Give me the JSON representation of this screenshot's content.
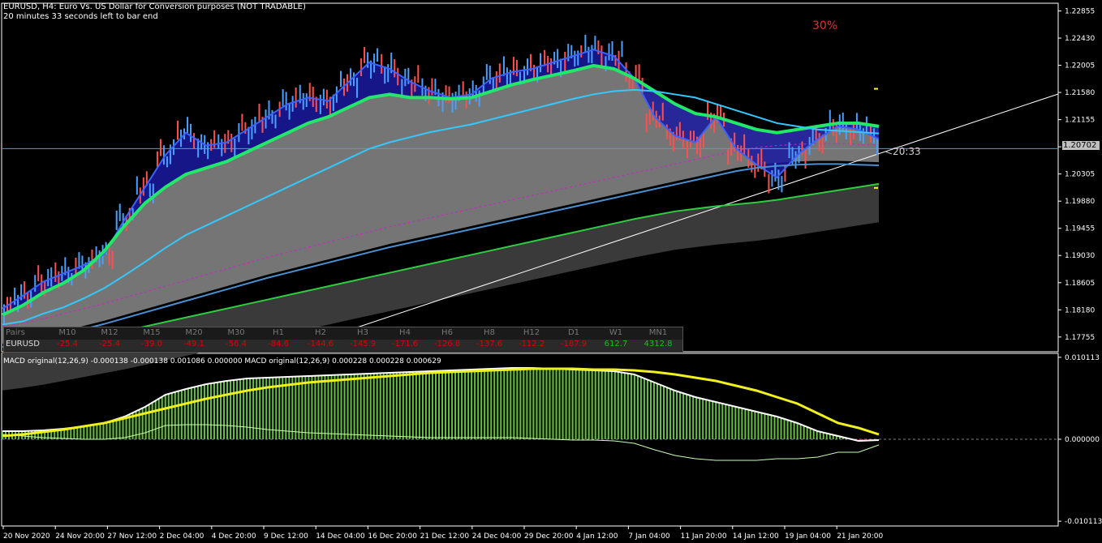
{
  "header": {
    "symbol_line": "EURUSD, H4:  Euro Vs. US Dollar for Conversion purposes (NOT TRADABLE)",
    "timer_line": "20 minutes 33 seconds left to bar end",
    "percent_label": "30%",
    "countdown_label": "<20:33",
    "current_price": "1.20702"
  },
  "macd": {
    "label": "MACD original(12,26,9) -0.000138 -0.000138 0.001086 0.000000 MACD original(12,26,9) 0.000228 0.000228 0.000629"
  },
  "mtf_table": {
    "header_label": "Pairs",
    "symbol": "EURUSD",
    "columns": [
      "M10",
      "M12",
      "M15",
      "M20",
      "M30",
      "H1",
      "H2",
      "H3",
      "H4",
      "H6",
      "H8",
      "H12",
      "D1",
      "W1",
      "MN1"
    ],
    "values": [
      "-25.4",
      "-25.4",
      "-39.0",
      "-49.1",
      "-56.4",
      "-84.6",
      "-144.6",
      "-145.9",
      "-171.6",
      "-126.8",
      "-137.6",
      "-112.2",
      "-187.9",
      "612.7",
      "4312.8"
    ],
    "value_colors": [
      "#e00000",
      "#e00000",
      "#e00000",
      "#e00000",
      "#e00000",
      "#e00000",
      "#e00000",
      "#e00000",
      "#e00000",
      "#e00000",
      "#e00000",
      "#e00000",
      "#e00000",
      "#18c018",
      "#18c018"
    ]
  },
  "chart_data": [
    {
      "type": "line",
      "title": "",
      "y_axis_ticks": [
        "1.22855",
        "1.22430",
        "1.22005",
        "1.21580",
        "1.21155",
        "1.20730",
        "1.20305",
        "1.19880",
        "1.19455",
        "1.19030",
        "1.18605",
        "1.18180",
        "1.17755"
      ],
      "ylim": [
        1.1755,
        1.2295
      ],
      "x_axis_ticks": [
        "20 Nov 2020",
        "24 Nov 20:00",
        "27 Nov 12:00",
        "2 Dec 04:00",
        "4 Dec 20:00",
        "9 Dec 12:00",
        "14 Dec 04:00",
        "16 Dec 20:00",
        "21 Dec 12:00",
        "24 Dec 04:00",
        "29 Dec 20:00",
        "4 Jan 12:00",
        "7 Jan 04:00",
        "11 Jan 20:00",
        "14 Jan 12:00",
        "19 Jan 04:00",
        "21 Jan 20:00"
      ],
      "series": [
        {
          "values": [
            1.182,
            1.184,
            1.1862,
            1.1875,
            1.1888,
            1.1905,
            1.196,
            1.201,
            1.206,
            1.2095,
            1.2075,
            1.208,
            1.21,
            1.212,
            1.214,
            1.215,
            1.2145,
            1.2175,
            1.2205,
            1.2195,
            1.2175,
            1.216,
            1.215,
            1.2155,
            1.218,
            1.219,
            1.2195,
            1.2205,
            1.2215,
            1.2225,
            1.2215,
            1.218,
            1.212,
            1.209,
            1.208,
            1.212,
            1.207,
            1.2045,
            1.2025,
            1.206,
            1.2085,
            1.2105,
            1.21,
            1.2085
          ]
        },
        {
          "values": [
            1.181,
            1.1825,
            1.1845,
            1.186,
            1.188,
            1.191,
            1.195,
            1.1985,
            1.201,
            1.203,
            1.204,
            1.205,
            1.2065,
            1.208,
            1.2095,
            1.211,
            1.212,
            1.2135,
            1.215,
            1.2155,
            1.215,
            1.215,
            1.2148,
            1.215,
            1.216,
            1.217,
            1.2178,
            1.2185,
            1.2192,
            1.22,
            1.2195,
            1.218,
            1.216,
            1.214,
            1.2125,
            1.212,
            1.211,
            1.21,
            1.2095,
            1.21,
            1.2105,
            1.211,
            1.211,
            1.2105
          ]
        },
        {
          "values": [
            1.1795,
            1.18,
            1.1812,
            1.1822,
            1.1836,
            1.1852,
            1.1872,
            1.1893,
            1.1915,
            1.1935,
            1.195,
            1.1965,
            1.198,
            1.1995,
            1.201,
            1.2025,
            1.204,
            1.2055,
            1.207,
            1.208,
            1.2088,
            1.2096,
            1.2102,
            1.2108,
            1.2116,
            1.2124,
            1.2132,
            1.214,
            1.2148,
            1.2155,
            1.216,
            1.2162,
            1.216,
            1.2155,
            1.215,
            1.214,
            1.213,
            1.212,
            1.211,
            1.2105,
            1.21,
            1.2098,
            1.2096,
            1.2094
          ]
        },
        {
          "values": [
            1.176,
            1.1765,
            1.1772,
            1.178,
            1.1788,
            1.1796,
            1.1805,
            1.1814,
            1.1823,
            1.1832,
            1.1841,
            1.185,
            1.1859,
            1.1868,
            1.1876,
            1.1884,
            1.1892,
            1.19,
            1.1908,
            1.1916,
            1.1923,
            1.193,
            1.1937,
            1.1944,
            1.1951,
            1.1958,
            1.1965,
            1.1972,
            1.1979,
            1.1986,
            1.1993,
            1.2,
            1.2007,
            1.2014,
            1.2021,
            1.2028,
            1.2035,
            1.204,
            1.2043,
            1.2045,
            1.2046,
            1.2046,
            1.2045,
            1.2044
          ]
        },
        {
          "values": [
            1.1752,
            1.1756,
            1.1761,
            1.1767,
            1.1773,
            1.1779,
            1.1785,
            1.1792,
            1.1799,
            1.1806,
            1.1813,
            1.182,
            1.1827,
            1.1834,
            1.1841,
            1.1848,
            1.1855,
            1.1862,
            1.1869,
            1.1876,
            1.1883,
            1.189,
            1.1897,
            1.1904,
            1.1911,
            1.1918,
            1.1925,
            1.1932,
            1.1939,
            1.1946,
            1.1953,
            1.196,
            1.1966,
            1.1972,
            1.1976,
            1.198,
            1.1983,
            1.1986,
            1.199,
            1.1995,
            1.2,
            1.2005,
            1.201,
            1.2015
          ]
        }
      ],
      "series_colors": [
        "#3c63ff",
        "#22e86a",
        "#34c8ff",
        "#4a8fd0",
        "#2ecc40"
      ],
      "colors": {
        "price_hline": "#3ab0c8",
        "trendline": "#ffffff",
        "ma_dashed": "#d020d0",
        "cloud": "#8a8a8a"
      }
    },
    {
      "type": "bar",
      "title": "",
      "y_axis_ticks": [
        "0.010113",
        "0.000000",
        "-0.010113"
      ],
      "ylim": [
        -0.0105,
        0.0105
      ],
      "series": [
        {
          "values": [
            0.001,
            0.001,
            0.0011,
            0.0013,
            0.0016,
            0.002,
            0.0028,
            0.004,
            0.0055,
            0.0062,
            0.0068,
            0.0072,
            0.0075,
            0.0076,
            0.0077,
            0.0078,
            0.0079,
            0.008,
            0.0081,
            0.0082,
            0.0083,
            0.0084,
            0.0085,
            0.0086,
            0.0087,
            0.0088,
            0.0088,
            0.0087,
            0.0086,
            0.0085,
            0.0084,
            0.008,
            0.007,
            0.006,
            0.0052,
            0.0046,
            0.004,
            0.0034,
            0.0028,
            0.002,
            0.001,
            0.0004,
            -0.0002,
            -0.0001
          ]
        },
        {
          "values": [
            0.0004,
            0.0006,
            0.0009,
            0.0012,
            0.0016,
            0.002,
            0.0026,
            0.0032,
            0.0038,
            0.0044,
            0.005,
            0.0055,
            0.006,
            0.0064,
            0.0067,
            0.007,
            0.0072,
            0.0074,
            0.0076,
            0.0078,
            0.008,
            0.0082,
            0.0083,
            0.0084,
            0.0085,
            0.0086,
            0.0087,
            0.0087,
            0.0087,
            0.0086,
            0.0086,
            0.0085,
            0.0083,
            0.008,
            0.0076,
            0.0072,
            0.0066,
            0.006,
            0.0052,
            0.0044,
            0.0032,
            0.002,
            0.0014,
            0.0006
          ]
        },
        {
          "values": [
            0.0006,
            0.0004,
            0.0002,
            0.0001,
            0.0,
            0.0,
            0.0002,
            0.0008,
            0.0017,
            0.0018,
            0.0018,
            0.0017,
            0.0015,
            0.0012,
            0.001,
            0.0008,
            0.0007,
            0.0006,
            0.0005,
            0.0004,
            0.0003,
            0.0002,
            0.0002,
            0.0002,
            0.0002,
            0.0002,
            0.0001,
            0.0,
            -0.0001,
            -0.0001,
            -0.0002,
            -0.0005,
            -0.0013,
            -0.002,
            -0.0024,
            -0.0026,
            -0.0026,
            -0.0026,
            -0.0024,
            -0.0024,
            -0.0022,
            -0.0016,
            -0.0016,
            -0.0007
          ]
        }
      ],
      "series_colors": [
        "#ffffff",
        "#f0f020",
        "#c8ffb0"
      ],
      "colors": {
        "hist_pos": "#66c040",
        "hist_neg": "#cc2020",
        "zero_line": "#808080"
      }
    }
  ]
}
